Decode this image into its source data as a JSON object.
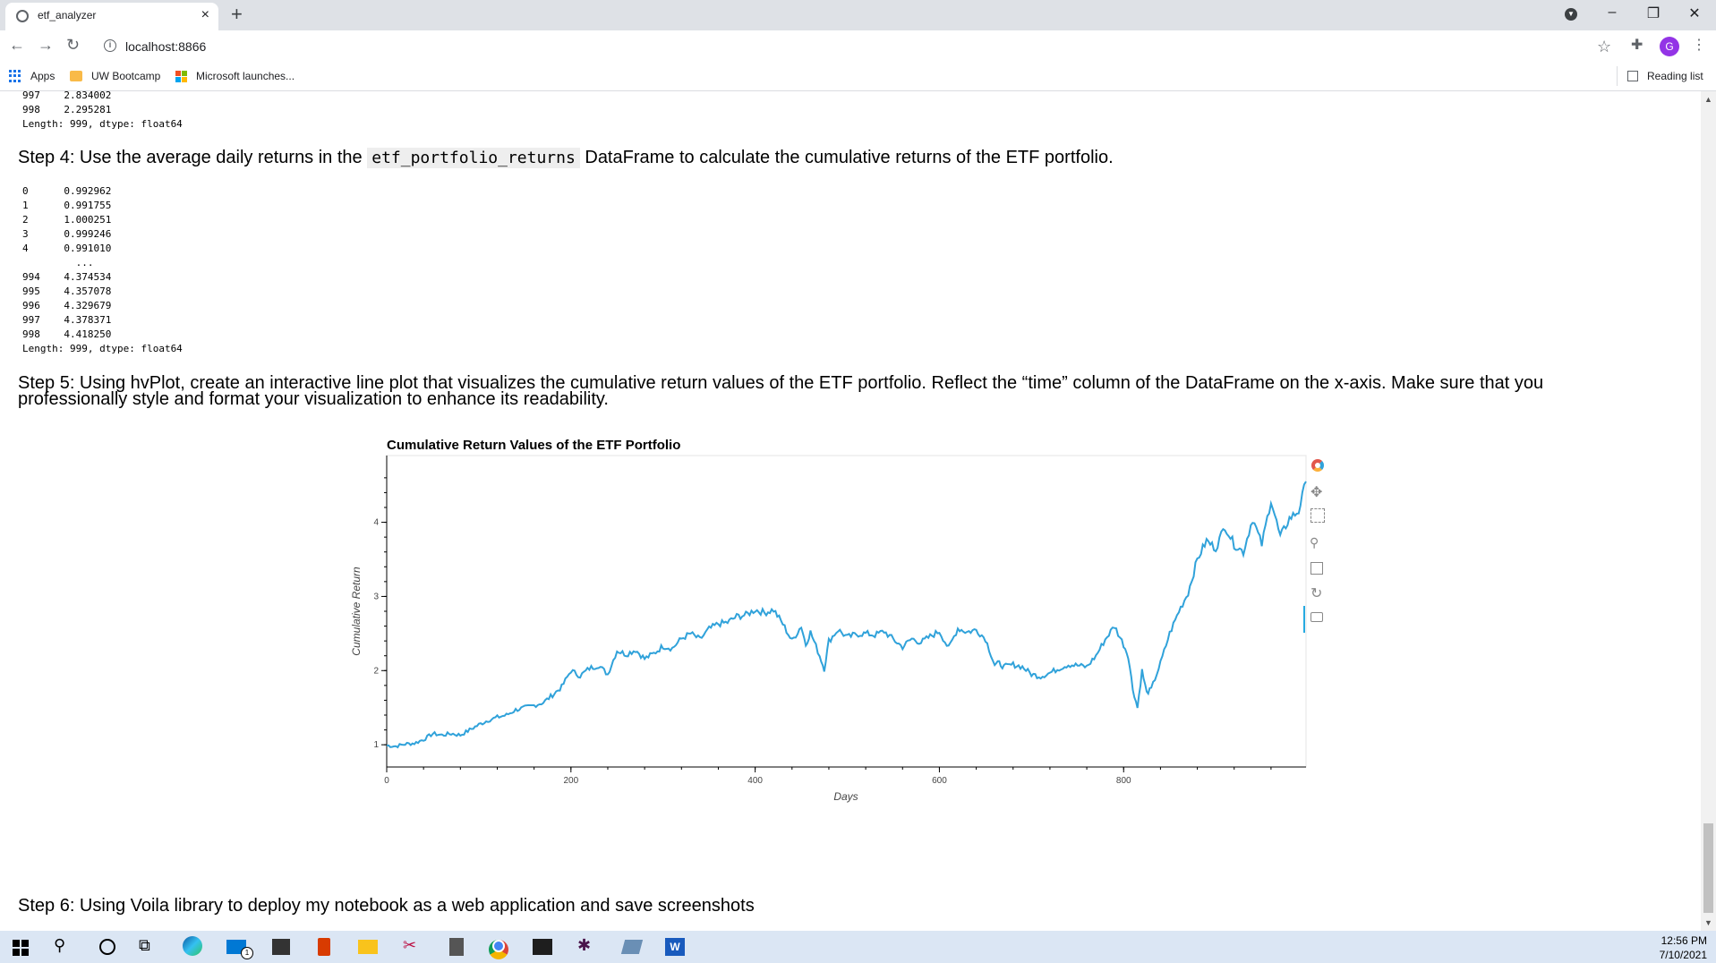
{
  "browser": {
    "tab_title": "etf_analyzer",
    "tab_close": "×",
    "new_tab": "+",
    "url": "localhost:8866",
    "bookmarks": [
      "Apps",
      "UW Bootcamp",
      "Microsoft launches..."
    ],
    "reading_list": "Reading list",
    "profile_initial": "G"
  },
  "notebook": {
    "prev_output": [
      "997    2.834002",
      "998    2.295281",
      "Length: 999, dtype: float64"
    ],
    "step4_pre": "Step 4: Use the average daily returns in the ",
    "step4_code": "etf_portfolio_returns",
    "step4_post": " DataFrame to calculate the cumulative returns of the ETF portfolio.",
    "step4_output": [
      "0      0.992962",
      "1      0.991755",
      "2      1.000251",
      "3      0.999246",
      "4      0.991010",
      "         ...",
      "994    4.374534",
      "995    4.357078",
      "996    4.329679",
      "997    4.378371",
      "998    4.418250",
      "Length: 999, dtype: float64"
    ],
    "step5_line1": "Step 5: Using hvPlot, create an interactive line plot that visualizes the cumulative return values of the ETF portfolio. Reflect the “time” column of the DataFrame on the x-axis. Make sure that you",
    "step5_line2": "professionally style and format your visualization to enhance its readability.",
    "step6": "Step 6: Using Voila library to deploy my notebook as a web application and save screenshots"
  },
  "chart_data": {
    "type": "line",
    "title": "Cumulative Return Values of the ETF Portfolio",
    "xlabel": "Days",
    "ylabel": "Cumulative Return",
    "xlim": [
      0,
      998
    ],
    "ylim": [
      0.7,
      4.9
    ],
    "xticks": [
      0,
      200,
      400,
      600,
      800
    ],
    "yticks": [
      1,
      2,
      3,
      4
    ],
    "color": "#30a2da",
    "series": [
      {
        "x": [
          0,
          10,
          20,
          30,
          40,
          50,
          60,
          70,
          80,
          90,
          100,
          110,
          120,
          130,
          140,
          150,
          160,
          170,
          180,
          190,
          200,
          210,
          220,
          230,
          240,
          250,
          260,
          270,
          280,
          290,
          300,
          310,
          320,
          330,
          340,
          350,
          360,
          370,
          380,
          390,
          400,
          410,
          420,
          430,
          440,
          450,
          455,
          460,
          470,
          475,
          480,
          490,
          500,
          510,
          520,
          530,
          540,
          550,
          560,
          570,
          580,
          590,
          600,
          610,
          620,
          630,
          640,
          650,
          660,
          665,
          670,
          680,
          690,
          700,
          710,
          720,
          730,
          740,
          750,
          760,
          770,
          780,
          790,
          800,
          805,
          810,
          815,
          820,
          825,
          830,
          840,
          850,
          860,
          870,
          880,
          890,
          900,
          910,
          920,
          930,
          940,
          950,
          960,
          970,
          980,
          990,
          998
        ],
        "y": [
          0.99,
          0.98,
          1.01,
          1.02,
          1.07,
          1.15,
          1.13,
          1.15,
          1.13,
          1.2,
          1.27,
          1.33,
          1.37,
          1.4,
          1.47,
          1.5,
          1.53,
          1.57,
          1.67,
          1.78,
          2.0,
          1.93,
          2.03,
          2.07,
          1.95,
          2.27,
          2.22,
          2.28,
          2.16,
          2.23,
          2.33,
          2.3,
          2.43,
          2.5,
          2.42,
          2.56,
          2.63,
          2.65,
          2.73,
          2.75,
          2.82,
          2.78,
          2.82,
          2.63,
          2.4,
          2.6,
          2.35,
          2.52,
          2.2,
          2.02,
          2.4,
          2.55,
          2.45,
          2.49,
          2.5,
          2.48,
          2.53,
          2.42,
          2.32,
          2.43,
          2.38,
          2.46,
          2.53,
          2.3,
          2.57,
          2.52,
          2.55,
          2.43,
          2.08,
          2.1,
          2.05,
          2.08,
          2.05,
          1.95,
          1.92,
          1.97,
          2.03,
          2.08,
          2.07,
          2.05,
          2.2,
          2.42,
          2.6,
          2.35,
          2.2,
          1.75,
          1.5,
          2.0,
          1.7,
          1.75,
          2.1,
          2.5,
          2.8,
          3.05,
          3.5,
          3.75,
          3.65,
          3.95,
          3.7,
          3.6,
          4.05,
          3.7,
          4.3,
          3.8,
          4.05,
          4.15,
          4.55
        ]
      }
    ]
  },
  "taskbar": {
    "time": "12:56 PM",
    "date": "7/10/2021",
    "mail_badge": "1"
  }
}
